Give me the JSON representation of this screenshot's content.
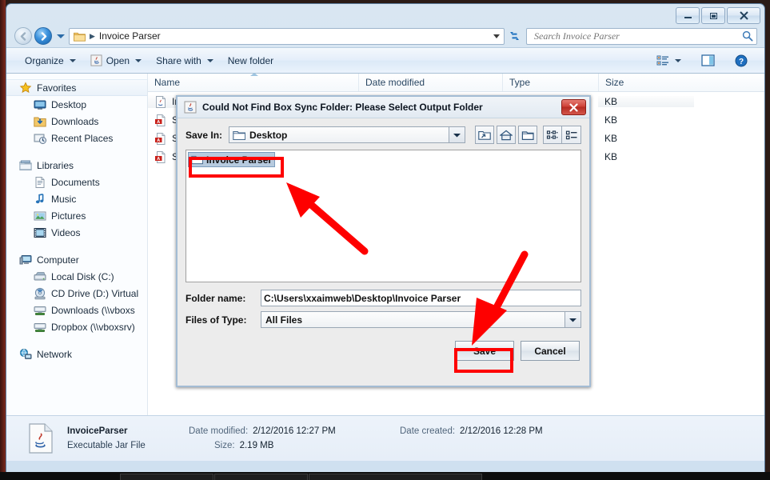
{
  "window": {
    "minimize_label": "Minimize",
    "maximize_label": "Maximize",
    "close_label": "Close"
  },
  "address": {
    "crumb": "Invoice Parser",
    "back_label": "Back",
    "forward_label": "Forward",
    "recent_label": "Recent pages"
  },
  "search": {
    "placeholder": "Search Invoice Parser",
    "value": ""
  },
  "commandbar": {
    "organize": "Organize",
    "open": "Open",
    "share_with": "Share with",
    "new_folder": "New folder"
  },
  "sidebar": {
    "groups": [
      {
        "header": "Favorites",
        "icon": "star-icon",
        "selected": true,
        "items": [
          {
            "label": "Desktop",
            "icon": "desktop-icon"
          },
          {
            "label": "Downloads",
            "icon": "downloads-icon"
          },
          {
            "label": "Recent Places",
            "icon": "recent-places-icon"
          }
        ]
      },
      {
        "header": "Libraries",
        "icon": "libraries-icon",
        "selected": false,
        "items": [
          {
            "label": "Documents",
            "icon": "documents-icon"
          },
          {
            "label": "Music",
            "icon": "music-icon"
          },
          {
            "label": "Pictures",
            "icon": "pictures-icon"
          },
          {
            "label": "Videos",
            "icon": "videos-icon"
          }
        ]
      },
      {
        "header": "Computer",
        "icon": "computer-icon",
        "selected": false,
        "items": [
          {
            "label": "Local Disk (C:)",
            "icon": "harddisk-icon"
          },
          {
            "label": "CD Drive (D:) Virtual",
            "icon": "cddrive-icon"
          },
          {
            "label": "Downloads (\\\\vboxs",
            "icon": "networkdrive-icon"
          },
          {
            "label": "Dropbox (\\\\vboxsrv)",
            "icon": "networkdrive-icon"
          }
        ]
      },
      {
        "header": "Network",
        "icon": "network-icon",
        "selected": false,
        "items": []
      }
    ]
  },
  "filelist": {
    "columns": [
      "Name",
      "Date modified",
      "Type",
      "Size"
    ],
    "rows": [
      {
        "name": "Inv",
        "size": "KB",
        "icon": "jar-file-icon",
        "selected": true
      },
      {
        "name": "So",
        "size": "KB",
        "icon": "pdf-file-icon",
        "selected": false
      },
      {
        "name": "So",
        "size": "KB",
        "icon": "pdf-file-icon",
        "selected": false
      },
      {
        "name": "So",
        "size": "KB",
        "icon": "pdf-file-icon",
        "selected": false
      }
    ]
  },
  "details": {
    "file_name": "InvoiceParser",
    "file_type": "Executable Jar File",
    "date_modified_label": "Date modified:",
    "date_modified_value": "2/12/2016 12:27 PM",
    "date_created_label": "Date created:",
    "date_created_value": "2/12/2016 12:28 PM",
    "size_label": "Size:",
    "size_value": "2.19 MB"
  },
  "dialog": {
    "title": "Could Not Find Box Sync Folder: Please Select Output Folder",
    "icon": "java-icon",
    "close_label": "Close",
    "save_in_label": "Save In:",
    "save_in_value": "Desktop",
    "toolbar": [
      {
        "name": "up-folder-icon",
        "tip": "Up One Level"
      },
      {
        "name": "home-icon",
        "tip": "Home"
      },
      {
        "name": "new-folder-icon",
        "tip": "Create New Folder"
      },
      {
        "name": "tiles-view-icon",
        "tip": "List"
      },
      {
        "name": "details-view-icon",
        "tip": "Details"
      }
    ],
    "list_items": [
      {
        "label": "Invoice Parser",
        "icon": "folder-icon",
        "selected": true
      }
    ],
    "folder_name_label": "Folder name:",
    "folder_name_value": "C:\\Users\\xxaimweb\\Desktop\\Invoice Parser",
    "files_of_type_label": "Files of Type:",
    "files_of_type_value": "All Files",
    "save_label": "Save",
    "cancel_label": "Cancel"
  },
  "colors": {
    "annotation": "#fe0000",
    "selection": "#b6cade",
    "explorer_chrome": "#d9e6f2"
  }
}
